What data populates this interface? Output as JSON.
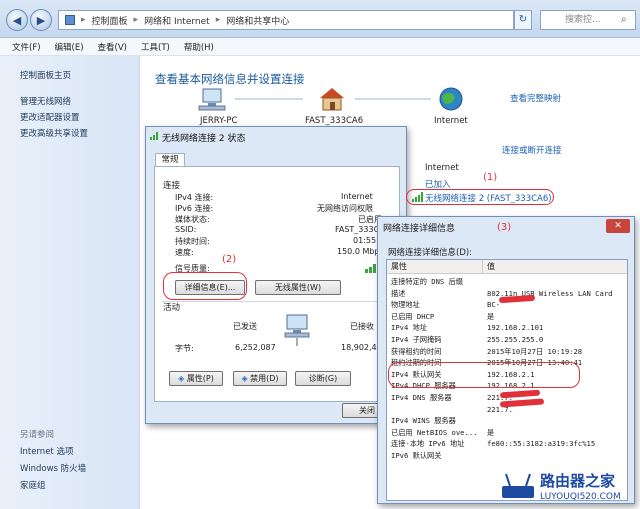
{
  "explorer": {
    "breadcrumb": [
      "控制面板",
      "网络和 Internet",
      "网络和共享中心"
    ],
    "search_placeholder": "搜索控...",
    "menu": [
      "文件(F)",
      "编辑(E)",
      "查看(V)",
      "工具(T)",
      "帮助(H)"
    ]
  },
  "sidebar": {
    "home": "控制面板主页",
    "links": [
      "管理无线网络",
      "更改适配器设置",
      "更改高级共享设置"
    ],
    "see_also": "另请参阅",
    "see_also_links": [
      "Internet 选项",
      "Windows 防火墙",
      "家庭组"
    ]
  },
  "main": {
    "title": "查看基本网络信息并设置连接",
    "view_full_map": "查看完整映射",
    "pc_name": "JERRY-PC",
    "router_name": "FAST_333CA6",
    "internet": "Internet",
    "connect_disconnect": "连接或断开连接",
    "access_type": "Internet",
    "homegroup": "已加入",
    "connection_link": "无线网络连接 2 (FAST_333CA6)"
  },
  "status_dialog": {
    "title": "无线网络连接 2 状态",
    "tab": "常规",
    "group_connection": "连接",
    "rows": [
      {
        "label": "IPv4 连接:",
        "value": "Internet"
      },
      {
        "label": "IPv6 连接:",
        "value": "无网络访问权限"
      },
      {
        "label": "媒体状态:",
        "value": "已启用"
      },
      {
        "label": "SSID:",
        "value": "FAST_333CA6"
      },
      {
        "label": "持续时间:",
        "value": "01:55:1"
      },
      {
        "label": "速度:",
        "value": "150.0 Mbps"
      }
    ],
    "signal_quality": "信号质量:",
    "details_button": "详细信息(E)...",
    "wireless_props_button": "无线属性(W)",
    "group_activity": "活动",
    "sent": "已发送",
    "received": "已接收",
    "bytes_label": "字节:",
    "bytes_sent": "6,252,087",
    "bytes_received": "18,902,470",
    "properties_button": "属性(P)",
    "disable_button": "禁用(D)",
    "diagnose_button": "诊断(G)",
    "close_button": "关闭"
  },
  "details_dialog": {
    "title": "网络连接详细信息",
    "list_label": "网络连接详细信息(D):",
    "col_property": "属性",
    "col_value": "值",
    "rows": [
      {
        "p": "连接特定的 DNS 后缀",
        "v": ""
      },
      {
        "p": "描述",
        "v": "802.11n USB Wireless LAN Card"
      },
      {
        "p": "物理地址",
        "v": "BC-"
      },
      {
        "p": "已启用 DHCP",
        "v": "是"
      },
      {
        "p": "IPv4 地址",
        "v": "192.168.2.101"
      },
      {
        "p": "IPv4 子网掩码",
        "v": "255.255.255.0"
      },
      {
        "p": "获得租约的时间",
        "v": "2015年10月27日 10:19:28"
      },
      {
        "p": "租约过期的时间",
        "v": "2015年10月27日 13:40:41"
      },
      {
        "p": "IPv4 默认网关",
        "v": "192.168.2.1"
      },
      {
        "p": "IPv4 DHCP 服务器",
        "v": "192.168.2.1"
      },
      {
        "p": "IPv4 DNS 服务器",
        "v": "221.7."
      },
      {
        "p": "",
        "v": "221.7."
      },
      {
        "p": "IPv4 WINS 服务器",
        "v": ""
      },
      {
        "p": "已启用 NetBIOS ove...",
        "v": "是"
      },
      {
        "p": "连接-本地 IPv6 地址",
        "v": "fe80::55:3182:a319:3fc%15"
      },
      {
        "p": "IPv6 默认网关",
        "v": ""
      }
    ]
  },
  "annotations": [
    "(1)",
    "(2)",
    "(3)"
  ],
  "watermark": {
    "cn": "路由器之家",
    "en": "LUYOUQI520.COM"
  }
}
